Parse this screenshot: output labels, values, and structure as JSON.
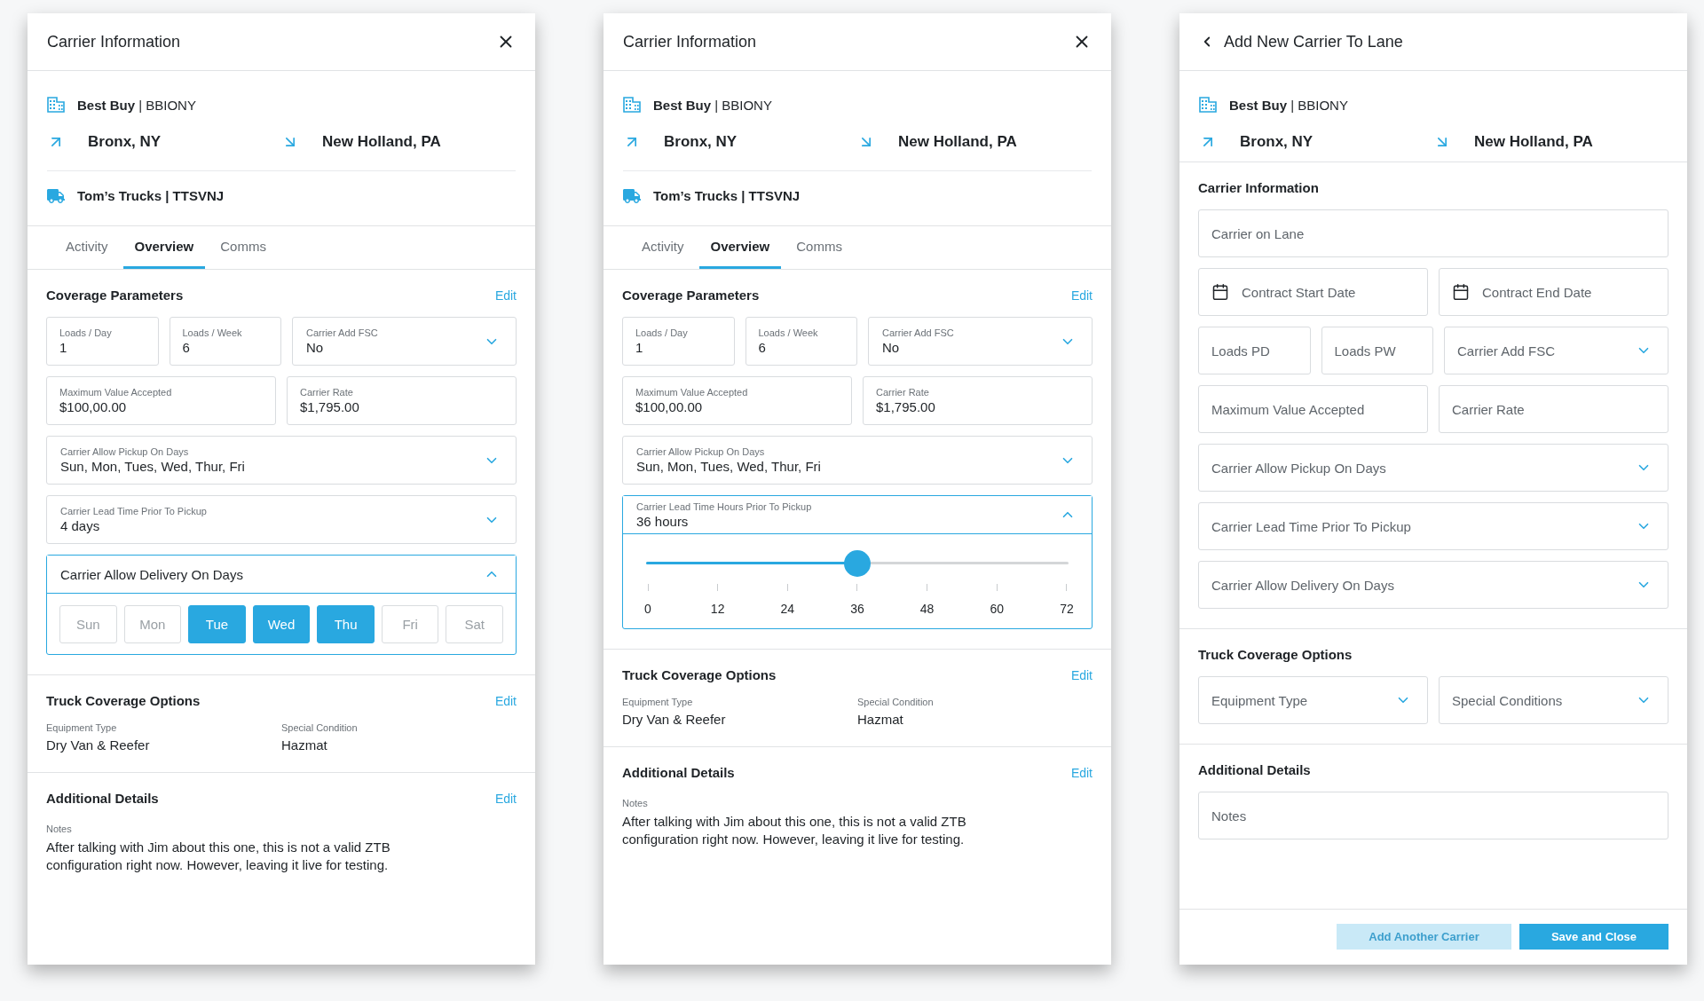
{
  "panels": [
    {
      "kind": "overview",
      "header": {
        "title": "Carrier Information",
        "back": false,
        "close": true
      },
      "shipper": "**Best Buy** | BBIONY",
      "origin": "Bronx, NY",
      "destination": "New Holland, PA",
      "carrier": "Tom’s Trucks | TTSVNJ",
      "tabs": [
        {
          "label": "Activity",
          "selected": false
        },
        {
          "label": "Overview",
          "selected": true
        },
        {
          "label": "Comms",
          "selected": false
        }
      ],
      "coverage": {
        "title": "Coverage Parameters",
        "edit": "Edit",
        "groups": [
          {
            "fields": [
              {
                "kind": "text",
                "label": "Loads / Day",
                "value": "1"
              },
              {
                "kind": "text",
                "label": "Loads / Week",
                "value": "6"
              },
              {
                "kind": "select",
                "label": "Carrier Add FSC",
                "value": "No",
                "expanded": false
              }
            ]
          },
          {
            "fields": [
              {
                "kind": "text",
                "label": "Maximum Value Accepted",
                "value": "$100,00.00"
              },
              {
                "kind": "text",
                "label": "Carrier Rate",
                "value": "$1,795.00"
              }
            ]
          },
          {
            "fields": [
              {
                "kind": "select",
                "label": "Carrier Allow Pickup On Days",
                "value": "Sun, Mon, Tues, Wed, Thur, Fri",
                "expanded": false
              }
            ]
          },
          {
            "fields": [
              {
                "kind": "select",
                "label": "Carrier Lead Time Prior To Pickup",
                "value": "4 days",
                "expanded": false
              }
            ]
          },
          {
            "fields": [
              {
                "kind": "days",
                "label": "Carrier Allow Delivery On Days",
                "expanded": true,
                "days": [
                  {
                    "label": "Sun",
                    "selected": false
                  },
                  {
                    "label": "Mon",
                    "selected": false
                  },
                  {
                    "label": "Tue",
                    "selected": true
                  },
                  {
                    "label": "Wed",
                    "selected": true
                  },
                  {
                    "label": "Thu",
                    "selected": true
                  },
                  {
                    "label": "Fri",
                    "selected": false
                  },
                  {
                    "label": "Sat",
                    "selected": false
                  }
                ]
              }
            ]
          }
        ]
      },
      "truck": {
        "title": "Truck Coverage Options",
        "edit": "Edit",
        "items": [
          {
            "label": "Equipment Type",
            "value": "Dry Van & Reefer"
          },
          {
            "label": "Special Condition",
            "value": "Hazmat"
          }
        ]
      },
      "additional": {
        "title": "Additional Details",
        "edit": "Edit",
        "notes_label": "Notes",
        "notes": "After talking with Jim about this one, this is not a valid ZTB configuration right now. However, leaving it live for testing."
      }
    },
    {
      "kind": "overview",
      "header": {
        "title": "Carrier Information",
        "back": false,
        "close": true
      },
      "shipper": "**Best Buy** | BBIONY",
      "origin": "Bronx, NY",
      "destination": "New Holland, PA",
      "carrier": "Tom’s Trucks | TTSVNJ",
      "tabs": [
        {
          "label": "Activity",
          "selected": false
        },
        {
          "label": "Overview",
          "selected": true
        },
        {
          "label": "Comms",
          "selected": false
        }
      ],
      "coverage": {
        "title": "Coverage Parameters",
        "edit": "Edit",
        "groups": [
          {
            "fields": [
              {
                "kind": "text",
                "label": "Loads / Day",
                "value": "1"
              },
              {
                "kind": "text",
                "label": "Loads / Week",
                "value": "6"
              },
              {
                "kind": "select",
                "label": "Carrier Add FSC",
                "value": "No",
                "expanded": false
              }
            ]
          },
          {
            "fields": [
              {
                "kind": "text",
                "label": "Maximum Value Accepted",
                "value": "$100,00.00"
              },
              {
                "kind": "text",
                "label": "Carrier Rate",
                "value": "$1,795.00"
              }
            ]
          },
          {
            "fields": [
              {
                "kind": "select",
                "label": "Carrier Allow Pickup On Days",
                "value": "Sun, Mon, Tues, Wed, Thur, Fri",
                "expanded": false
              }
            ]
          },
          {
            "fields": [
              {
                "kind": "slider",
                "label": "Carrier Lead Time Hours Prior To Pickup",
                "value": "36 hours",
                "expanded": true,
                "level": 0.5,
                "ticks": [
                  "0",
                  "12",
                  "24",
                  "36",
                  "48",
                  "60",
                  "72"
                ]
              }
            ]
          }
        ]
      },
      "truck": {
        "title": "Truck Coverage Options",
        "edit": "Edit",
        "items": [
          {
            "label": "Equipment Type",
            "value": "Dry Van & Reefer"
          },
          {
            "label": "Special Condition",
            "value": "Hazmat"
          }
        ]
      },
      "additional": {
        "title": "Additional Details",
        "edit": "Edit",
        "notes_label": "Notes",
        "notes": "After talking with Jim about this one, this is not a valid ZTB configuration right now. However, leaving it live for testing."
      }
    },
    {
      "kind": "form",
      "header": {
        "title": "Add New Carrier To Lane",
        "back": true,
        "close": false
      },
      "shipper": "**Best Buy** | BBIONY",
      "origin": "Bronx, NY",
      "destination": "New Holland, PA",
      "sections": [
        {
          "title": "Carrier Information",
          "groups": [
            {
              "fields": [
                {
                  "kind": "input",
                  "placeholder": "Carrier on Lane"
                }
              ]
            },
            {
              "fields": [
                {
                  "kind": "date",
                  "placeholder": "Contract Start Date"
                },
                {
                  "kind": "date",
                  "placeholder": "Contract End Date"
                }
              ]
            },
            {
              "fields": [
                {
                  "kind": "input",
                  "placeholder": "Loads PD"
                },
                {
                  "kind": "input",
                  "placeholder": "Loads PW"
                },
                {
                  "kind": "select",
                  "placeholder": "Carrier Add FSC"
                }
              ]
            },
            {
              "fields": [
                {
                  "kind": "input",
                  "placeholder": "Maximum Value Accepted"
                },
                {
                  "kind": "input",
                  "placeholder": "Carrier Rate"
                }
              ]
            },
            {
              "fields": [
                {
                  "kind": "select",
                  "placeholder": "Carrier Allow Pickup On Days"
                }
              ]
            },
            {
              "fields": [
                {
                  "kind": "select",
                  "placeholder": "Carrier Lead Time Prior To Pickup"
                }
              ]
            },
            {
              "fields": [
                {
                  "kind": "select",
                  "placeholder": "Carrier Allow Delivery On Days"
                }
              ]
            }
          ]
        },
        {
          "title": "Truck Coverage Options",
          "groups": [
            {
              "fields": [
                {
                  "kind": "select",
                  "placeholder": "Equipment Type"
                },
                {
                  "kind": "select",
                  "placeholder": "Special Conditions"
                }
              ]
            }
          ]
        },
        {
          "title": "Additional Details",
          "groups": [
            {
              "fields": [
                {
                  "kind": "input",
                  "placeholder": "Notes"
                }
              ]
            }
          ]
        }
      ],
      "buttons": [
        {
          "label": "Add Another Carrier",
          "disabled": true
        },
        {
          "label": "Save and Close",
          "disabled": false
        }
      ]
    }
  ]
}
